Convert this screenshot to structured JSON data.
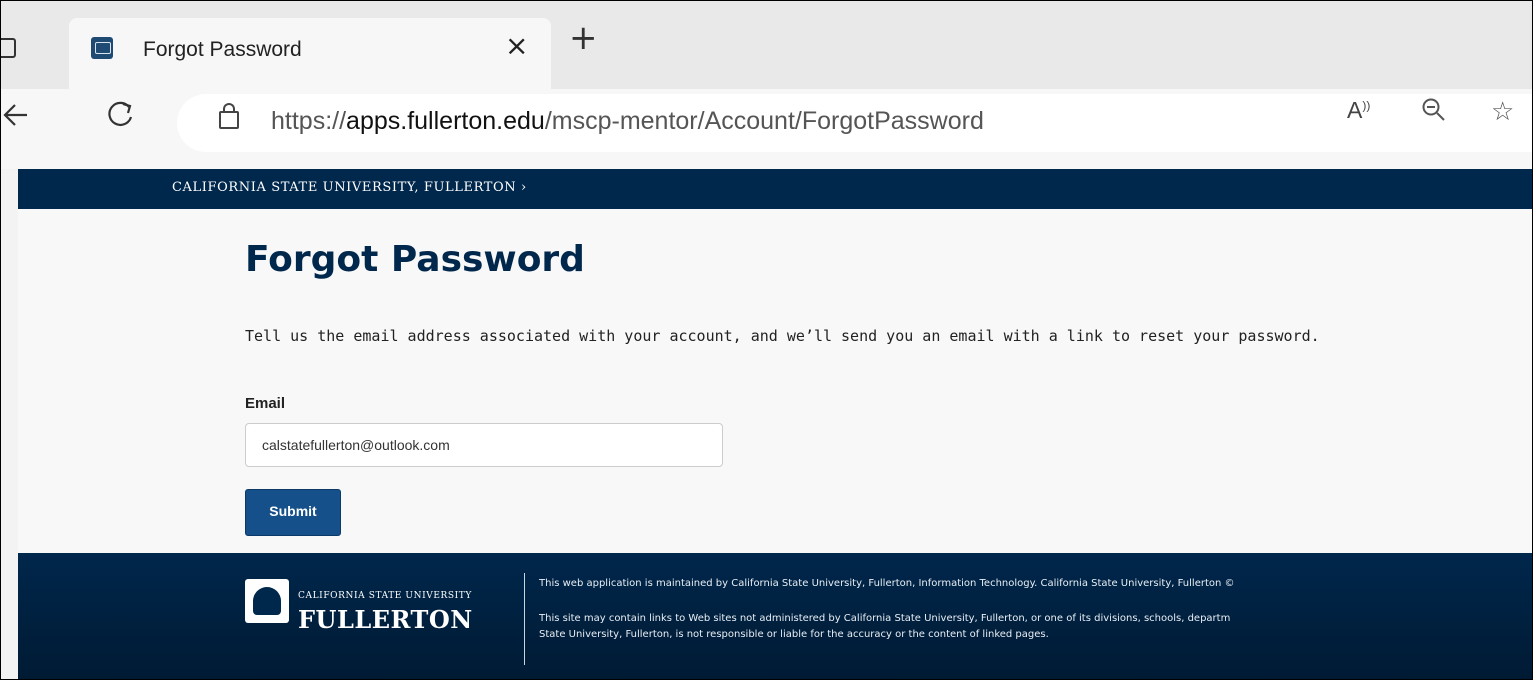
{
  "browser": {
    "tab_title": "Forgot Password",
    "tab_close": "×",
    "new_tab": "+",
    "url_prefix": "https://",
    "url_host": "apps.fullerton.edu",
    "url_path": "/mscp-mentor/Account/ForgotPassword",
    "read_aloud": "A⁢)",
    "icons": [
      "window-icon",
      "favicon-icon",
      "back-icon",
      "reload-icon",
      "lock-icon",
      "read-aloud-icon",
      "zoom-icon",
      "favorite-icon"
    ]
  },
  "header": {
    "brand": "CALIFORNIA STATE UNIVERSITY, FULLERTON ›"
  },
  "page": {
    "title": "Forgot Password",
    "intro": "Tell us the email address associated with your account, and we’ll send you an email with a link to reset your password.",
    "email_label": "Email",
    "email_value": "calstatefullerton@outlook.com",
    "submit_label": "Submit"
  },
  "footer": {
    "logo_small": "CALIFORNIA STATE UNIVERSITY",
    "logo_big": "FULLERTON",
    "line1": "This web application is maintained by California State University, Fullerton, Information Technology. California State University, Fullerton ©",
    "line2": "This site may contain links to Web sites not administered by California State University, Fullerton, or one of its divisions, schools, departm",
    "line3": "State University, Fullerton, is not responsible or liable for the accuracy or the content of linked pages."
  },
  "colors": {
    "navy": "#00274c",
    "button": "#16508a"
  }
}
